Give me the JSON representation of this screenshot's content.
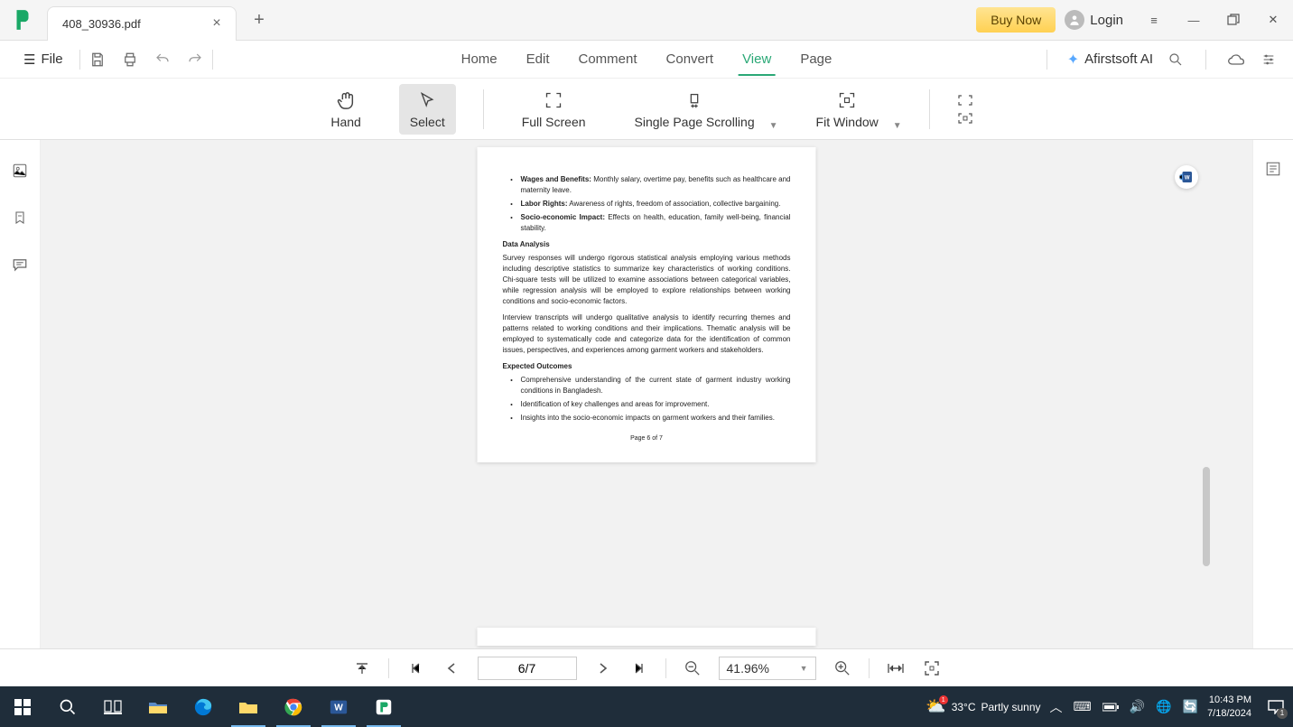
{
  "titlebar": {
    "tab_title": "408_30936.pdf",
    "buy_now": "Buy Now",
    "login": "Login"
  },
  "menubar": {
    "file": "File",
    "items": [
      "Home",
      "Edit",
      "Comment",
      "Convert",
      "View",
      "Page"
    ],
    "active_index": 4,
    "ai_label": "Afirstsoft AI"
  },
  "toolbar": {
    "hand": "Hand",
    "select": "Select",
    "fullscreen": "Full Screen",
    "single_page": "Single Page Scrolling",
    "fit_window": "Fit Window"
  },
  "document": {
    "bullets_a": [
      {
        "label": "Wages and Benefits:",
        "text": " Monthly salary, overtime pay, benefits such as healthcare and maternity leave."
      },
      {
        "label": "Labor Rights:",
        "text": " Awareness of rights, freedom of association, collective bargaining."
      },
      {
        "label": "Socio-economic Impact:",
        "text": " Effects on health, education, family well-being, financial stability."
      }
    ],
    "heading_analysis": "Data Analysis",
    "para1": "Survey responses will undergo rigorous statistical analysis employing various methods including descriptive statistics to summarize key characteristics of working conditions. Chi-square tests will be utilized to examine associations between categorical variables, while regression analysis will be employed to explore relationships between working conditions and socio-economic factors.",
    "para2": "Interview transcripts will undergo qualitative analysis to identify recurring themes and patterns related to working conditions and their implications. Thematic analysis will be employed to systematically code and categorize data for the identification of common issues, perspectives, and experiences among garment workers and stakeholders.",
    "heading_outcomes": "Expected Outcomes",
    "bullets_b": [
      "Comprehensive understanding of the current state of garment industry working conditions in Bangladesh.",
      "Identification of key challenges and areas for improvement.",
      "Insights into the socio-economic impacts on garment workers and their families."
    ],
    "footer": "Page 6 of 7"
  },
  "statusbar": {
    "page_value": "6/7",
    "zoom_value": "41.96%"
  },
  "taskbar": {
    "weather_temp": "33°C",
    "weather_desc": "Partly sunny",
    "weather_badge": "1",
    "time": "10:43 PM",
    "date": "7/18/2024",
    "notif_count": "1"
  }
}
